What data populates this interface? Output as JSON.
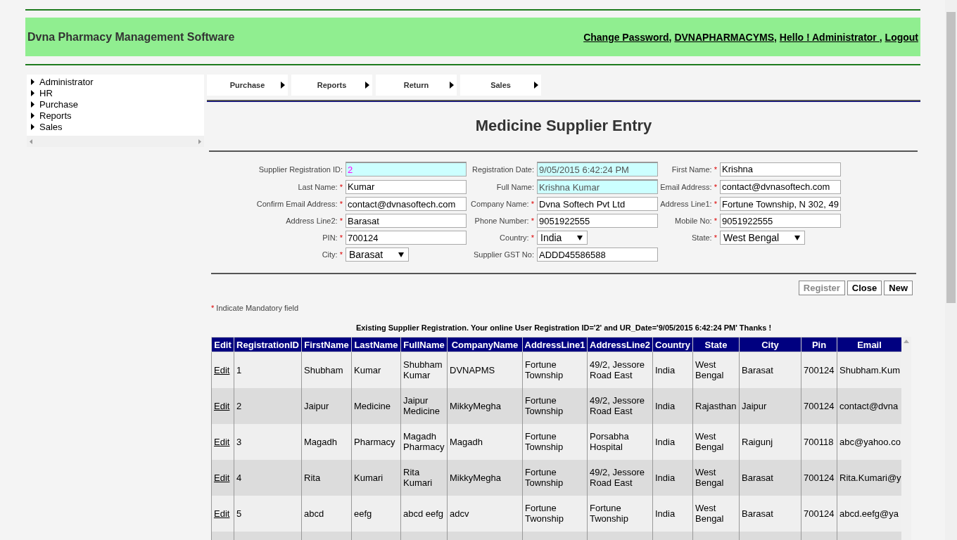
{
  "header": {
    "title": "Dvna Pharmacy Management Software",
    "links": [
      "Change Password,",
      "DVNAPHARMACYMS,",
      "Hello ! Administrator ,",
      "Logout"
    ]
  },
  "sidebar": {
    "items": [
      {
        "label": "Administrator"
      },
      {
        "label": "HR"
      },
      {
        "label": "Purchase"
      },
      {
        "label": "Reports"
      },
      {
        "label": "Sales"
      }
    ]
  },
  "menu": [
    {
      "label": "Purchase"
    },
    {
      "label": "Reports"
    },
    {
      "label": "Return"
    },
    {
      "label": "Sales"
    }
  ],
  "page_title": "Medicine Supplier Entry",
  "form": {
    "fields": [
      {
        "label": "Supplier Registration ID:",
        "required": false,
        "kind": "highlight",
        "value": "2"
      },
      {
        "label": "Registration Date:",
        "required": false,
        "kind": "readonly",
        "value": "9/05/2015 6:42:24 PM"
      },
      {
        "label": "First Name:",
        "required": true,
        "kind": "text",
        "value": "Krishna"
      },
      {
        "label": "Last Name:",
        "required": true,
        "kind": "text",
        "value": "Kumar"
      },
      {
        "label": "Full Name:",
        "required": false,
        "kind": "readonly",
        "value": "Krishna Kumar"
      },
      {
        "label": "Email Address:",
        "required": true,
        "kind": "text",
        "value": "contact@dvnasoftech.com"
      },
      {
        "label": "Confirm Email Address:",
        "required": true,
        "kind": "text",
        "value": "contact@dvnasoftech.com"
      },
      {
        "label": "Company Name:",
        "required": true,
        "kind": "text",
        "value": "Dvna Softech Pvt Ltd"
      },
      {
        "label": "Address Line1:",
        "required": true,
        "kind": "text",
        "value": "Fortune Township, N 302, 49"
      },
      {
        "label": "Address Line2:",
        "required": true,
        "kind": "text",
        "value": "Barasat"
      },
      {
        "label": "Phone Number:",
        "required": true,
        "kind": "text",
        "value": "9051922555"
      },
      {
        "label": "Mobile No:",
        "required": true,
        "kind": "text",
        "value": "9051922555"
      },
      {
        "label": "PIN:",
        "required": true,
        "kind": "text",
        "value": "700124"
      },
      {
        "label": "Country:",
        "required": true,
        "kind": "select",
        "value": "India"
      },
      {
        "label": "State:",
        "required": true,
        "kind": "select",
        "value": "West Bengal"
      },
      {
        "label": "City:",
        "required": true,
        "kind": "select",
        "value": "Barasat"
      },
      {
        "label": "Supplier GST No:",
        "required": false,
        "kind": "text",
        "value": "ADDD45586588"
      }
    ]
  },
  "buttons": [
    {
      "label": "Register",
      "disabled": true
    },
    {
      "label": "Close",
      "disabled": false
    },
    {
      "label": "New",
      "disabled": false
    }
  ],
  "mandatory_note": {
    "mark": "*",
    "text": "Indicate Mandatory field"
  },
  "table": {
    "caption": "Existing Supplier Registration. Your online User Registration ID='2' and UR_Date='9/05/2015 6:42:24 PM' Thanks !",
    "columns": [
      "Edit",
      "RegistrationID",
      "FirstName",
      "LastName",
      "FullName",
      "CompanyName",
      "AddressLine1",
      "AddressLine2",
      "Country",
      "State",
      "City",
      "Pin",
      "Email"
    ],
    "rows": [
      {
        "cells": [
          "Edit",
          "1",
          "Shubham",
          "Kumar",
          "Shubham Kumar",
          "DVNAPMS",
          "Fortune Township",
          "49/2, Jessore Road East",
          "India",
          "West Bengal",
          "Barasat",
          "700124",
          "Shubham.Kum"
        ]
      },
      {
        "cells": [
          "Edit",
          "2",
          "Jaipur",
          "Medicine",
          "Jaipur Medicine",
          "MikkyMegha",
          "Fortune Township",
          "49/2, Jessore Road East",
          "India",
          "Rajasthan",
          "Jaipur",
          "700124",
          "contact@dvna"
        ]
      },
      {
        "cells": [
          "Edit",
          "3",
          "Magadh",
          "Pharmacy",
          "Magadh Pharmacy",
          "Magadh",
          "Fortune Township",
          "Porsabha Hospital",
          "India",
          "West Bengal",
          "Raigunj",
          "700118",
          "abc@yahoo.co"
        ]
      },
      {
        "cells": [
          "Edit",
          "4",
          "Rita",
          "Kumari",
          "Rita Kumari",
          "MikkyMegha",
          "Fortune Township",
          "49/2, Jessore Road East",
          "India",
          "West Bengal",
          "Barasat",
          "700124",
          "Rita.Kumari@y"
        ]
      },
      {
        "cells": [
          "Edit",
          "5",
          "abcd",
          "eefg",
          "abcd eefg",
          "adcv",
          "Fortune Twonship",
          "Fortune Twonship",
          "India",
          "West Bengal",
          "Barasat",
          "700124",
          "abcd.eefg@ya"
        ]
      }
    ]
  }
}
